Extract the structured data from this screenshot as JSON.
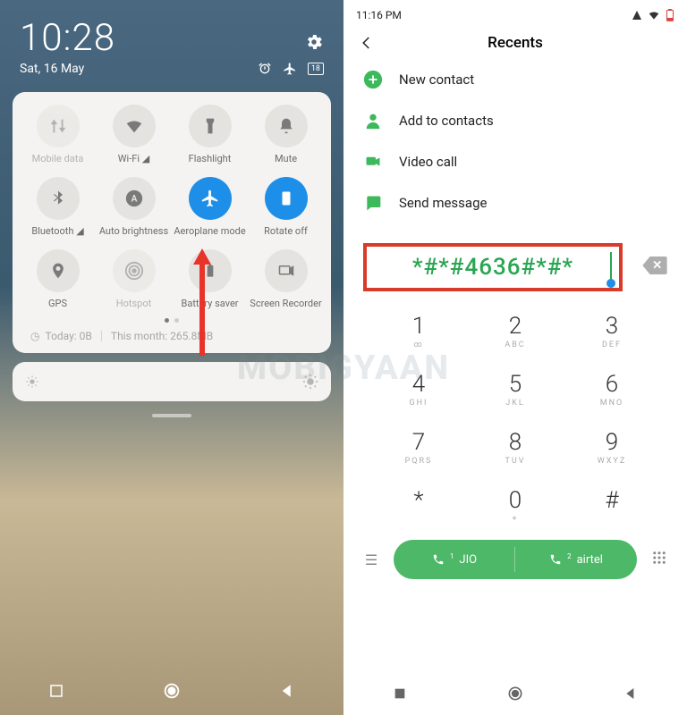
{
  "left": {
    "time": "10:28",
    "date": "Sat, 16 May",
    "tiles": [
      {
        "name": "mobile-data",
        "label": "Mobile data",
        "active": false,
        "dim": true
      },
      {
        "name": "wifi",
        "label": "Wi-Fi ◢",
        "active": false,
        "dim": false
      },
      {
        "name": "flashlight",
        "label": "Flashlight",
        "active": false,
        "dim": false
      },
      {
        "name": "mute",
        "label": "Mute",
        "active": false,
        "dim": false
      },
      {
        "name": "bluetooth",
        "label": "Bluetooth ◢",
        "active": false,
        "dim": false
      },
      {
        "name": "auto-brightness",
        "label": "Auto brightness",
        "active": false,
        "dim": false
      },
      {
        "name": "aeroplane-mode",
        "label": "Aeroplane mode",
        "active": true,
        "dim": false
      },
      {
        "name": "rotate-off",
        "label": "Rotate off",
        "active": true,
        "dim": false
      },
      {
        "name": "gps",
        "label": "GPS",
        "active": false,
        "dim": false
      },
      {
        "name": "hotspot",
        "label": "Hotspot",
        "active": false,
        "dim": true
      },
      {
        "name": "battery-saver",
        "label": "Battery saver",
        "active": false,
        "dim": false
      },
      {
        "name": "screen-recorder",
        "label": "Screen Recorder",
        "active": false,
        "dim": false
      }
    ],
    "data_today_label": "Today: 0B",
    "data_month_label": "This month: 265.8MB"
  },
  "right": {
    "clock": "11:16 PM",
    "title": "Recents",
    "menu": [
      {
        "name": "new-contact",
        "label": "New contact",
        "color": "#3cb95a"
      },
      {
        "name": "add-to-contacts",
        "label": "Add to contacts",
        "color": "#3cb95a"
      },
      {
        "name": "video-call",
        "label": "Video call",
        "color": "#3cb95a"
      },
      {
        "name": "send-message",
        "label": "Send message",
        "color": "#3cb95a"
      }
    ],
    "dial_number": "*#*#4636#*#*",
    "keys": [
      {
        "num": "1",
        "sub": "∞"
      },
      {
        "num": "2",
        "sub": "ABC"
      },
      {
        "num": "3",
        "sub": "DEF"
      },
      {
        "num": "4",
        "sub": "GHI"
      },
      {
        "num": "5",
        "sub": "JKL"
      },
      {
        "num": "6",
        "sub": "MNO"
      },
      {
        "num": "7",
        "sub": "PQRS"
      },
      {
        "num": "8",
        "sub": "TUV"
      },
      {
        "num": "9",
        "sub": "WXYZ"
      },
      {
        "num": "*",
        "sub": ""
      },
      {
        "num": "0",
        "sub": "+"
      },
      {
        "num": "#",
        "sub": ""
      }
    ],
    "sim1": {
      "name": "JIO",
      "idx": "1"
    },
    "sim2": {
      "name": "airtel",
      "idx": "2"
    }
  },
  "watermark": "MOBIGYAAN"
}
